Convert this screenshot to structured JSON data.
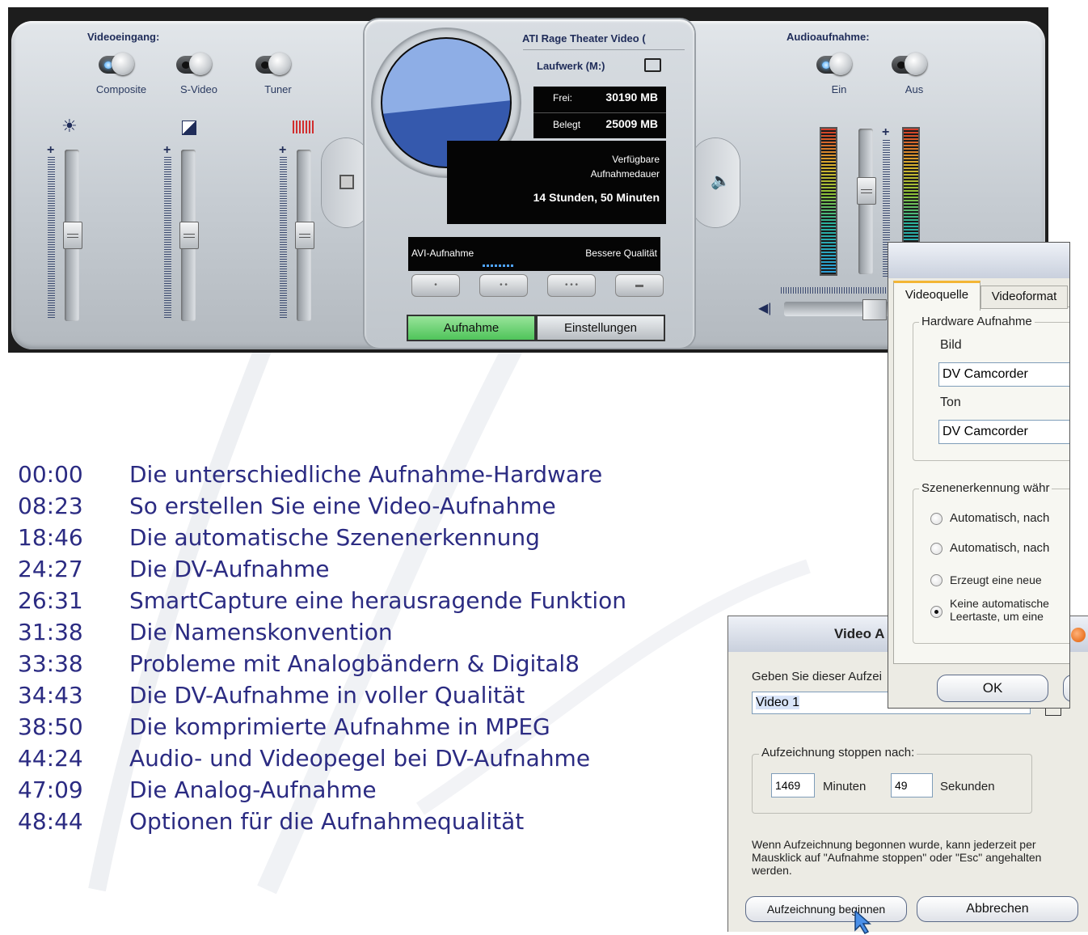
{
  "capture_panel": {
    "video_input": {
      "title": "Videoeingang:",
      "options": [
        {
          "label": "Composite",
          "on": true
        },
        {
          "label": "S-Video",
          "on": false
        },
        {
          "label": "Tuner",
          "on": false
        }
      ],
      "slider_icons": [
        "brightness-icon",
        "contrast-icon",
        "saturation-icon"
      ],
      "slider_plus": "+"
    },
    "audio": {
      "title": "Audioaufnahme:",
      "options": [
        {
          "label": "Ein",
          "on": true
        },
        {
          "label": "Aus",
          "on": false
        }
      ],
      "slider_plus": "+"
    },
    "console": {
      "source": "ATI Rage Theater Video (",
      "drive": "Laufwerk (M:)",
      "free_label": "Frei:",
      "free_value": "30190 MB",
      "used_label": "Belegt",
      "used_value": "25009 MB",
      "remaining_line1": "Verfügbare",
      "remaining_line2": "Aufnahmedauer",
      "remaining_value": "14 Stunden, 50 Minuten",
      "quality_left": "AVI-Aufnahme",
      "quality_right": "Bessere Qualität",
      "tab_capture": "Aufnahme",
      "tab_settings": "Einstellungen"
    }
  },
  "settings_dialog": {
    "tabs": [
      "Videoquelle",
      "Videoformat"
    ],
    "hardware_group": "Hardware Aufnahme",
    "image_label": "Bild",
    "image_value": "DV Camcorder",
    "sound_label": "Ton",
    "sound_value": "DV Camcorder",
    "scene_group": "Szenenerkennung währ",
    "radios": [
      {
        "label": "Automatisch, nach",
        "selected": false
      },
      {
        "label": "Automatisch, nach",
        "selected": false
      },
      {
        "label": "Erzeugt eine neue",
        "selected": false
      },
      {
        "label": "Keine automatische",
        "label2": "Leertaste, um eine",
        "selected": true
      }
    ],
    "ok_button": "OK"
  },
  "capture_dialog": {
    "title": "Video A",
    "name_prompt": "Geben Sie dieser Aufzei",
    "name_value": "Video 1",
    "stop_group": "Aufzeichnung stoppen nach:",
    "minutes_value": "1469",
    "minutes_label": "Minuten",
    "seconds_value": "49",
    "seconds_label": "Sekunden",
    "info": "Wenn Aufzeichnung begonnen wurde, kann jederzeit per Mausklick auf \"Aufnahme stoppen\" oder \"Esc\" angehalten werden.",
    "start_button": "Aufzeichnung beginnen",
    "cancel_button": "Abbrechen"
  },
  "chapters": [
    {
      "time": "00:00",
      "title": "Die unterschiedliche Aufnahme-Hardware"
    },
    {
      "time": "08:23",
      "title": "So erstellen Sie eine Video-Aufnahme"
    },
    {
      "time": "18:46",
      "title": "Die automatische Szenenerkennung"
    },
    {
      "time": "24:27",
      "title": "Die DV-Aufnahme"
    },
    {
      "time": "26:31",
      "title": "SmartCapture  eine herausragende Funktion"
    },
    {
      "time": "31:38",
      "title": "Die Namenskonvention"
    },
    {
      "time": "33:38",
      "title": "Probleme mit Analogbändern & Digital8"
    },
    {
      "time": "34:43",
      "title": "Die DV-Aufnahme in voller Qualität"
    },
    {
      "time": "38:50",
      "title": "Die komprimierte Aufnahme in MPEG"
    },
    {
      "time": "44:24",
      "title": "Audio- und Videopegel bei DV-Aufnahme"
    },
    {
      "time": "47:09",
      "title": "Die Analog-Aufnahme"
    },
    {
      "time": "48:44",
      "title": "Optionen für die Aufnahmequalität"
    }
  ]
}
